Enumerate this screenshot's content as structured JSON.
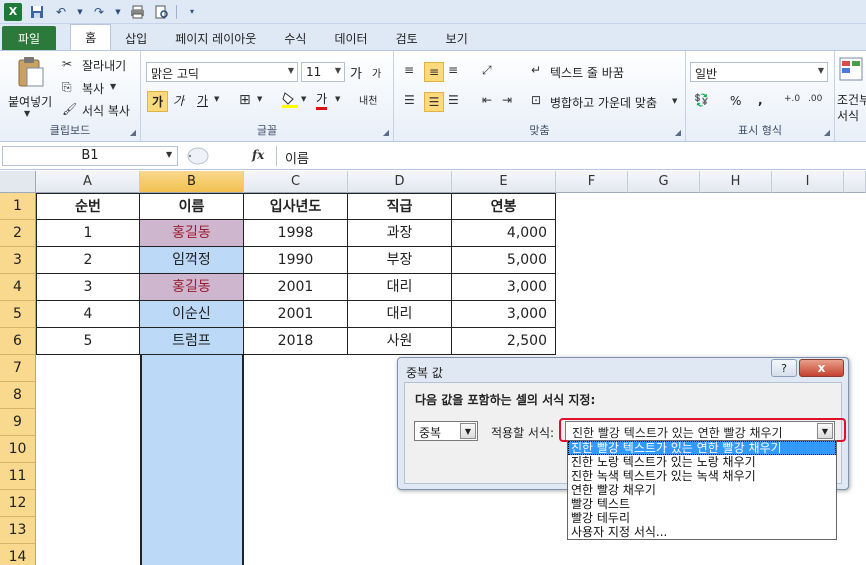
{
  "app": {
    "logo": "X",
    "qat_icons": [
      "excel-logo",
      "save-icon",
      "undo-icon",
      "redo-icon",
      "print-icon",
      "print-preview-icon"
    ]
  },
  "ribbon_tabs": [
    {
      "label": "파일"
    },
    {
      "label": "홈"
    },
    {
      "label": "삽입"
    },
    {
      "label": "페이지 레이아웃"
    },
    {
      "label": "수식"
    },
    {
      "label": "데이터"
    },
    {
      "label": "검토"
    },
    {
      "label": "보기"
    }
  ],
  "ribbon": {
    "clipboard": {
      "label": "클립보드",
      "paste": "붙여넣기",
      "cut": "잘라내기",
      "copy": "복사",
      "format_painter": "서식 복사"
    },
    "font": {
      "label": "글꼴",
      "font_name": "맑은 고딕",
      "font_size": "11",
      "bold": "가",
      "italic": "가",
      "underline": "가",
      "font_color": "가",
      "grow": "가",
      "shrink": "가",
      "phonetic": "내천"
    },
    "alignment": {
      "label": "맞춤",
      "wrap_text": "텍스트 줄 바꿈",
      "merge_center": "병합하고 가운데 맞춤"
    },
    "number": {
      "label": "표시 형식",
      "format": "일반",
      "percent": "%",
      "comma": ","
    },
    "styles": {
      "conditional_label": "조건부",
      "format_label": "서식"
    }
  },
  "formula_bar": {
    "name_box": "B1",
    "fx": "fx",
    "content": "이름"
  },
  "sheet": {
    "columns": [
      "A",
      "B",
      "C",
      "D",
      "E",
      "F",
      "G",
      "H",
      "I"
    ],
    "rows": [
      "1",
      "2",
      "3",
      "4",
      "5",
      "6",
      "7",
      "8",
      "9",
      "10",
      "11",
      "12",
      "13",
      "14"
    ],
    "header": [
      "순번",
      "이름",
      "입사년도",
      "직급",
      "연봉"
    ],
    "data": [
      [
        "1",
        "홍길동",
        "1998",
        "과장",
        "4,000"
      ],
      [
        "2",
        "임꺽정",
        "1990",
        "부장",
        "5,000"
      ],
      [
        "3",
        "홍길동",
        "2001",
        "대리",
        "3,000"
      ],
      [
        "4",
        "이순신",
        "2001",
        "대리",
        "3,000"
      ],
      [
        "5",
        "트럼프",
        "2018",
        "사원",
        "2,500"
      ]
    ],
    "selected_column": "B",
    "duplicate_fill": "#cfb6cf",
    "duplicate_text": "#9c1b2e",
    "selection_fill": "#bcd9f7"
  },
  "dialog": {
    "title": "중복 값",
    "help": "?",
    "close": "x",
    "heading": "다음 값을 포함하는 셀의 서식 지정:",
    "type_value": "중복",
    "format_label": "적용할 서식:",
    "format_value": "진한 빨강 텍스트가 있는 연한 빨강 채우기",
    "options": [
      "진한 빨강 텍스트가 있는 연한 빨강 채우기",
      "진한 노랑 텍스트가 있는 노랑 채우기",
      "진한 녹색 텍스트가 있는 녹색 채우기",
      "연한 빨강 채우기",
      "빨강 텍스트",
      "빨강 테두리",
      "사용자 지정 서식..."
    ],
    "selected_option": 0
  }
}
